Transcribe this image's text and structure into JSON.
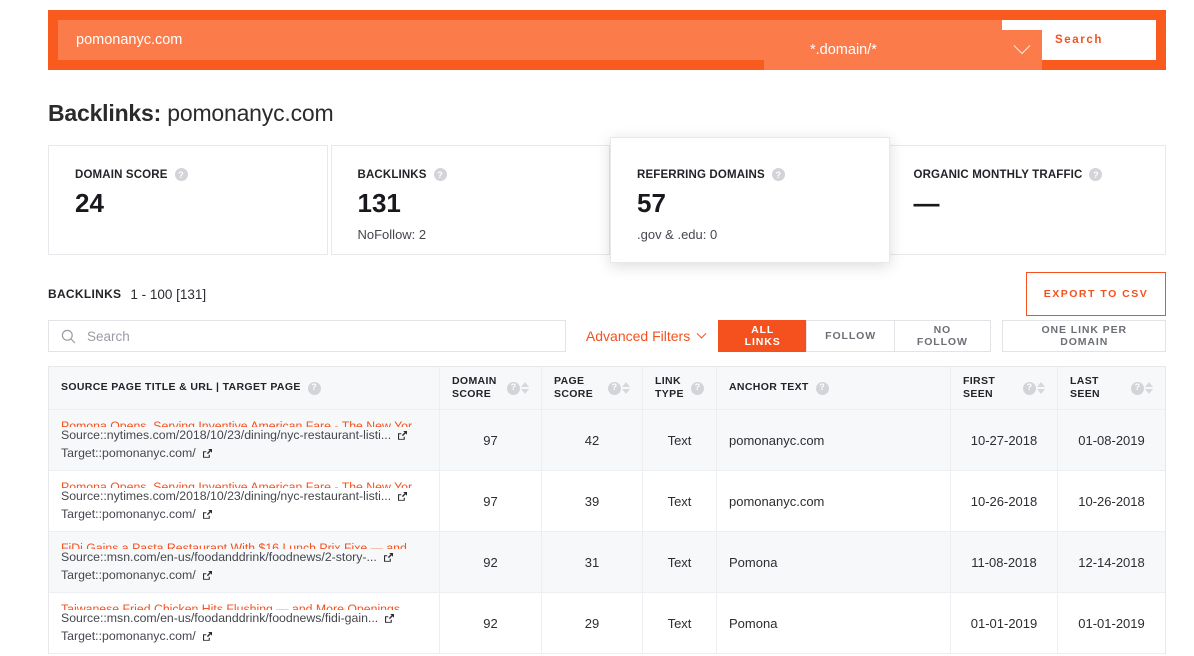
{
  "search": {
    "domain_value": "pomonanyc.com",
    "domain_placeholder": "pomonanyc.com",
    "mode_selected": "*.domain/*",
    "search_button": "Search"
  },
  "header": {
    "title_label": "Backlinks:",
    "title_value": "pomonanyc.com"
  },
  "cards": [
    {
      "label": "DOMAIN SCORE",
      "value": "24",
      "sub": "",
      "help": "?",
      "raised": false
    },
    {
      "label": "BACKLINKS",
      "value": "131",
      "sub": "NoFollow: 2",
      "help": "?",
      "raised": false
    },
    {
      "label": "REFERRING DOMAINS",
      "value": "57",
      "sub": ".gov & .edu: 0",
      "help": "?",
      "raised": true
    },
    {
      "label": "ORGANIC MONTHLY TRAFFIC",
      "value": "—",
      "sub": "",
      "help": "?",
      "raised": false
    }
  ],
  "backlinks_bar": {
    "label": "BACKLINKS",
    "range": "1 - 100 [131]",
    "export_label": "EXPORT TO CSV"
  },
  "filters": {
    "search_placeholder": "Search",
    "search_value": "",
    "advanced_label": "Advanced Filters",
    "segments": [
      {
        "label": "ALL LINKS",
        "active": true
      },
      {
        "label": "FOLLOW",
        "active": false
      },
      {
        "label": "NO FOLLOW",
        "active": false
      }
    ],
    "one_per_domain": "ONE LINK PER DOMAIN"
  },
  "table": {
    "columns": [
      {
        "label": "SOURCE PAGE TITLE & URL | TARGET PAGE",
        "help": "?",
        "sortable": false
      },
      {
        "label": "DOMAIN SCORE",
        "help": "?",
        "sortable": true
      },
      {
        "label": "PAGE SCORE",
        "help": "?",
        "sortable": true
      },
      {
        "label": "LINK TYPE",
        "help": "?",
        "sortable": false
      },
      {
        "label": "ANCHOR TEXT",
        "help": "?",
        "sortable": false
      },
      {
        "label": "FIRST SEEN",
        "help": "?",
        "sortable": true
      },
      {
        "label": "LAST SEEN",
        "help": "?",
        "sortable": true
      }
    ],
    "source_prefix": "Source::",
    "target_prefix": "Target::",
    "rows": [
      {
        "title": "Pomona Opens, Serving Inventive American Fare - The New York Times",
        "source": "nytimes.com/2018/10/23/dining/nyc-restaurant-listi...",
        "target": "pomonanyc.com/",
        "domain_score": "97",
        "page_score": "42",
        "link_type": "Text",
        "anchor_text": "pomonanyc.com",
        "first_seen": "10-27-2018",
        "last_seen": "01-08-2019"
      },
      {
        "title": "Pomona Opens, Serving Inventive American Fare - The New York Times",
        "source": "nytimes.com/2018/10/23/dining/nyc-restaurant-listi...",
        "target": "pomonanyc.com/",
        "domain_score": "97",
        "page_score": "39",
        "link_type": "Text",
        "anchor_text": "pomonanyc.com",
        "first_seen": "10-26-2018",
        "last_seen": "10-26-2018"
      },
      {
        "title": "FiDi Gains a Pasta Restaurant With $16 Lunch Prix Fixe — and More Ope...",
        "source": "msn.com/en-us/foodanddrink/foodnews/2-story-...",
        "target": "pomonanyc.com/",
        "domain_score": "92",
        "page_score": "31",
        "link_type": "Text",
        "anchor_text": "Pomona",
        "first_seen": "11-08-2018",
        "last_seen": "12-14-2018"
      },
      {
        "title": "Taiwanese Fried Chicken Hits Flushing — and More Openings",
        "source": "msn.com/en-us/foodanddrink/foodnews/fidi-gain...",
        "target": "pomonanyc.com/",
        "domain_score": "92",
        "page_score": "29",
        "link_type": "Text",
        "anchor_text": "Pomona",
        "first_seen": "01-01-2019",
        "last_seen": "01-01-2019"
      }
    ]
  },
  "colors": {
    "brand_orange": "#f4511e",
    "bar_orange": "#f95a1e",
    "input_orange": "#fb7b4b"
  }
}
